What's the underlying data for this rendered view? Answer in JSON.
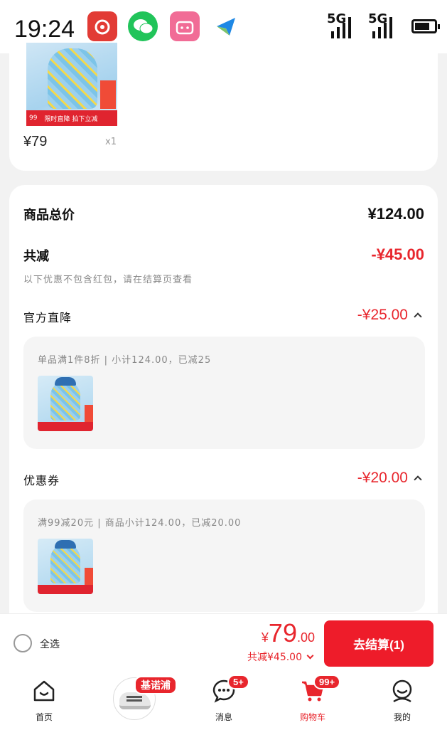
{
  "status_bar": {
    "time": "19:24",
    "signal_1": "5G",
    "signal_2": "5G",
    "battery_level": 0.75
  },
  "top_item": {
    "price": "¥79",
    "quantity": "x1",
    "banner_price": "99",
    "banner_text": "限时直降 拍下立减"
  },
  "summary": {
    "total_label": "商品总价",
    "total_value": "¥124.00",
    "reduce_label": "共减",
    "reduce_value": "-¥45.00",
    "note": "以下优惠不包含红包，请在结算页查看",
    "official": {
      "label": "官方直降",
      "value": "-¥25.00",
      "detail": "单品满1件8折 | 小计124.00，已减25"
    },
    "coupon": {
      "label": "优惠券",
      "value": "-¥20.00",
      "detail": "满99减20元 | 商品小计124.00，已减20.00"
    }
  },
  "checkout": {
    "select_all": "全选",
    "currency": "¥",
    "price_int": "79",
    "price_dec": ".00",
    "total_reduce": "共减¥45.00",
    "button": "去结算(1)"
  },
  "tabbar": {
    "home": "首页",
    "brand_badge": "基诺浦",
    "messages": "消息",
    "messages_badge": "5+",
    "cart": "购物车",
    "cart_badge": "99+",
    "me": "我的"
  },
  "colors": {
    "accent": "#e8262d",
    "button": "#ee1c2a"
  }
}
